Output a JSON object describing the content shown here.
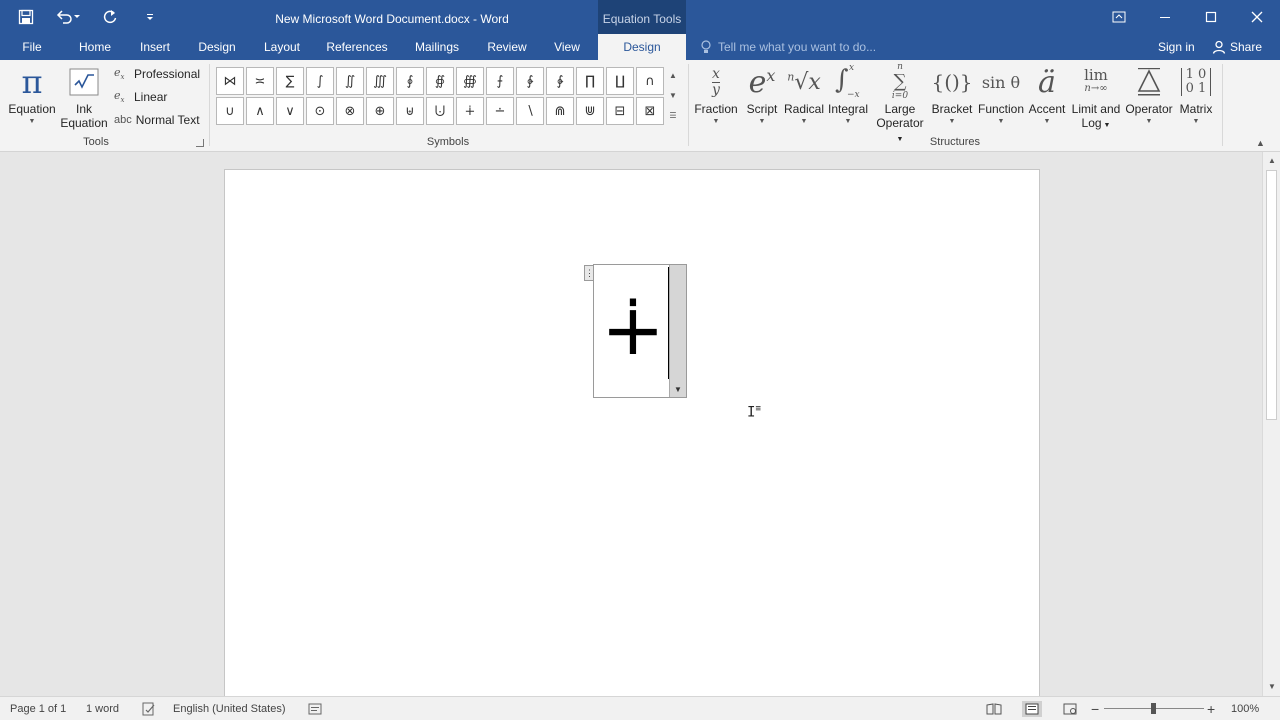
{
  "window": {
    "title": "New Microsoft Word Document.docx - Word",
    "context_tab_group": "Equation Tools"
  },
  "qat": {
    "save_icon": "save-icon",
    "undo_icon": "undo-icon",
    "redo_icon": "repeat-icon",
    "customize_icon": "customize-qat-icon"
  },
  "tabs": [
    "File",
    "Home",
    "Insert",
    "Design",
    "Layout",
    "References",
    "Mailings",
    "Review",
    "View",
    "Design"
  ],
  "tellme": {
    "placeholder": "Tell me what you want to do..."
  },
  "account": {
    "signin": "Sign in",
    "share": "Share"
  },
  "ribbon": {
    "tools": {
      "label": "Tools",
      "equation": "Equation",
      "ink_equation_1": "Ink",
      "ink_equation_2": "Equation",
      "professional": "Professional",
      "linear": "Linear",
      "normal_text": "Normal Text",
      "normal_text_icon": "abc"
    },
    "symbols": {
      "label": "Symbols",
      "row1": [
        "⋈",
        "≍",
        "∑",
        "∫",
        "∬",
        "∭",
        "∮",
        "∯",
        "∰",
        "⨍",
        "∲",
        "∳",
        "∏",
        "∐",
        "∩"
      ],
      "row2": [
        "∪",
        "∧",
        "∨",
        "⊙",
        "⊗",
        "⊕",
        "⊎",
        "⨃",
        "∔",
        "∸",
        "∖",
        "⋒",
        "⋓",
        "⊟",
        "⊠"
      ]
    },
    "structures": {
      "label": "Structures",
      "items": [
        {
          "l1": "Fraction",
          "l2": "",
          "icon": "x/y"
        },
        {
          "l1": "Script",
          "l2": "",
          "icon": "eˣ"
        },
        {
          "l1": "Radical",
          "l2": "",
          "icon": "ⁿ√x"
        },
        {
          "l1": "Integral",
          "l2": "",
          "icon": "∫"
        },
        {
          "l1": "Large",
          "l2": "Operator",
          "icon": "∑"
        },
        {
          "l1": "Bracket",
          "l2": "",
          "icon": "{()}"
        },
        {
          "l1": "Function",
          "l2": "",
          "icon": "sinθ"
        },
        {
          "l1": "Accent",
          "l2": "",
          "icon": "ä"
        },
        {
          "l1": "Limit and",
          "l2": "Log",
          "icon": "lim"
        },
        {
          "l1": "Operator",
          "l2": "",
          "icon": "Δ"
        },
        {
          "l1": "Matrix",
          "l2": "",
          "icon": "[10/01]"
        }
      ],
      "lim_sub": "n→∞",
      "intg_sup": "x",
      "intg_sub": "−x",
      "sum_sup": "n",
      "sum_sub": "i=0"
    }
  },
  "document": {
    "equation_symbol": "∔",
    "handle": "⋮"
  },
  "statusbar": {
    "page": "Page 1 of 1",
    "words": "1 word",
    "language": "English (United States)",
    "zoom": "100%",
    "zoom_level": 100
  }
}
